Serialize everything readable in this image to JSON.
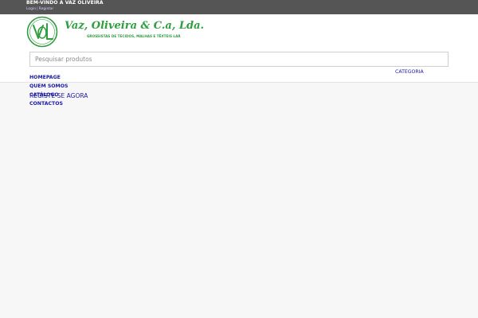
{
  "topbar": {
    "welcome": "BEM-VINDO À VAZ OLIVEIRA",
    "login": "Login",
    "separator": "|",
    "register": "Registar"
  },
  "brand": {
    "name": "Vaz, Oliveira & C.a, Lda.",
    "tagline": "GROSSISTAS DE TECIDOS, MALHAS E TÊXTEIS LAR",
    "color": "#2e9e3f",
    "logo_icon": "vol-monogram-logo"
  },
  "search": {
    "placeholder": "Pesquisar produtos"
  },
  "category": {
    "label": "CATEGORIA"
  },
  "nav": {
    "items": [
      {
        "label": "HOMEPAGE"
      },
      {
        "label": "QUEM SOMOS"
      },
      {
        "label": "CATÁLOGO"
      },
      {
        "label": "CONTACTOS"
      }
    ]
  },
  "cta": {
    "label": "REGISTE-SE AGORA"
  },
  "colors": {
    "topbar": "#555555",
    "link": "#1a1aa6",
    "background": "#f7f7f7"
  }
}
